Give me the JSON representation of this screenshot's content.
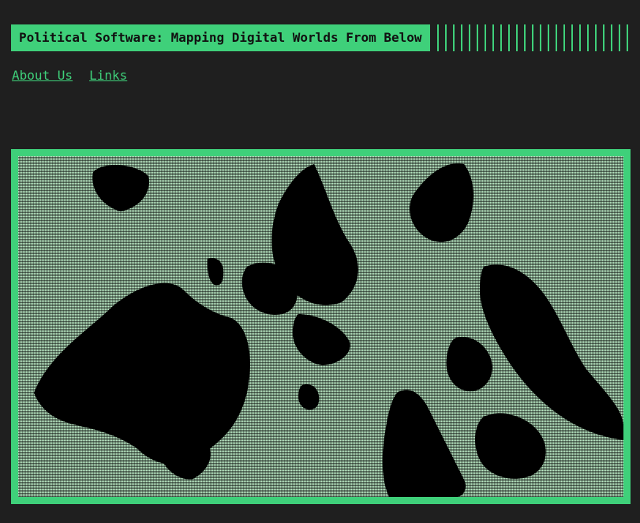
{
  "header": {
    "title": "Political Software: Mapping Digital Worlds From Below"
  },
  "nav": {
    "items": [
      {
        "label": "About Us"
      },
      {
        "label": "Links"
      }
    ]
  },
  "map": {
    "icon": "ascii-world-map",
    "colors": {
      "accent": "#3fd07a",
      "background": "#1f1f1f",
      "land": "#000000",
      "ocean": "#bfeec9"
    }
  }
}
